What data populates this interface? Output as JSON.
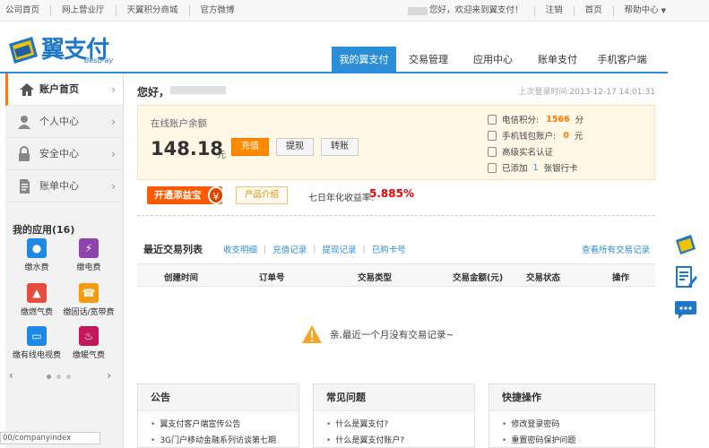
{
  "topbar": {
    "links": [
      "公司首页",
      "网上营业厅",
      "天翼积分商城",
      "官方微博"
    ],
    "greeting": "您好，欢迎来到翼支付！",
    "logout": "注销",
    "home": "首页",
    "help": "帮助中心"
  },
  "header": {
    "logo_text": "翼支付",
    "logo_sub": "BestPay",
    "tabs": [
      "我的翼支付",
      "交易管理",
      "应用中心",
      "账单支付",
      "手机客户端"
    ],
    "active_tab": "我的翼支付"
  },
  "sidebar": {
    "items": [
      {
        "label": "账户首页",
        "icon": "home-icon"
      },
      {
        "label": "个人中心",
        "icon": "person-icon"
      },
      {
        "label": "安全中心",
        "icon": "lock-icon"
      },
      {
        "label": "账单中心",
        "icon": "document-icon"
      }
    ],
    "apps_title": "我的应用(16)",
    "apps": [
      {
        "label": "缴水费",
        "icon": "water-drop-icon",
        "color": "#1e88e5"
      },
      {
        "label": "缴电费",
        "icon": "lightning-icon",
        "color": "#8e44ad"
      },
      {
        "label": "缴燃气费",
        "icon": "flame-icon",
        "color": "#e74c3c"
      },
      {
        "label": "缴固话/宽带费",
        "icon": "phone-icon",
        "color": "#f39c12"
      },
      {
        "label": "缴有线电视费",
        "icon": "tv-icon",
        "color": "#1e88e5"
      },
      {
        "label": "缴暖气费",
        "icon": "heater-icon",
        "color": "#c2185b"
      }
    ]
  },
  "main": {
    "greeting": "您好，",
    "last_login_label": "上次登录时间:",
    "last_login": "2013-12-17 14:01:31",
    "balance": {
      "label": "在线账户余额",
      "amount": "148.18",
      "unit": "元",
      "recharge": "充值",
      "withdraw": "提现",
      "transfer": "转账"
    },
    "account_info": {
      "points_label": "电信积分:",
      "points": "1566",
      "points_unit": "分",
      "wallet_label": "手机钱包账户:",
      "wallet": "0",
      "wallet_unit": "元",
      "realname": "高级实名认证",
      "bank_prefix": "已添加",
      "bank_count": "1",
      "bank_suffix": "张银行卡"
    },
    "yeb": {
      "button": "开通添益宝",
      "coin": "¥",
      "product_intro": "产品介绍",
      "yield_label": "七日年化收益率:",
      "yield_value": "5.885%"
    },
    "transactions": {
      "title": "最近交易列表",
      "links": [
        "收支明细",
        "充值记录",
        "提现记录",
        "已购卡号"
      ],
      "view_all": "查看所有交易记录",
      "columns": [
        "创建时间",
        "订单号",
        "交易类型",
        "交易金额(元)",
        "交易状态",
        "操作"
      ],
      "empty_message": "亲,最近一个月没有交易记录~"
    },
    "panels": [
      {
        "title": "公告",
        "items": [
          "翼支付客户端宣传公告",
          "3G门户移动金融系列访谈第七期"
        ]
      },
      {
        "title": "常见问题",
        "items": [
          "什么是翼支付?",
          "什么是翼支付账户?"
        ]
      },
      {
        "title": "快捷操作",
        "items": [
          "修改登录密码",
          "重置密码保护问题"
        ]
      }
    ]
  },
  "status_url": "00/companyindex",
  "colors": {
    "brand_blue": "#2d8ed8",
    "accent_orange": "#ff8a00",
    "highlight_red": "#e00000"
  }
}
